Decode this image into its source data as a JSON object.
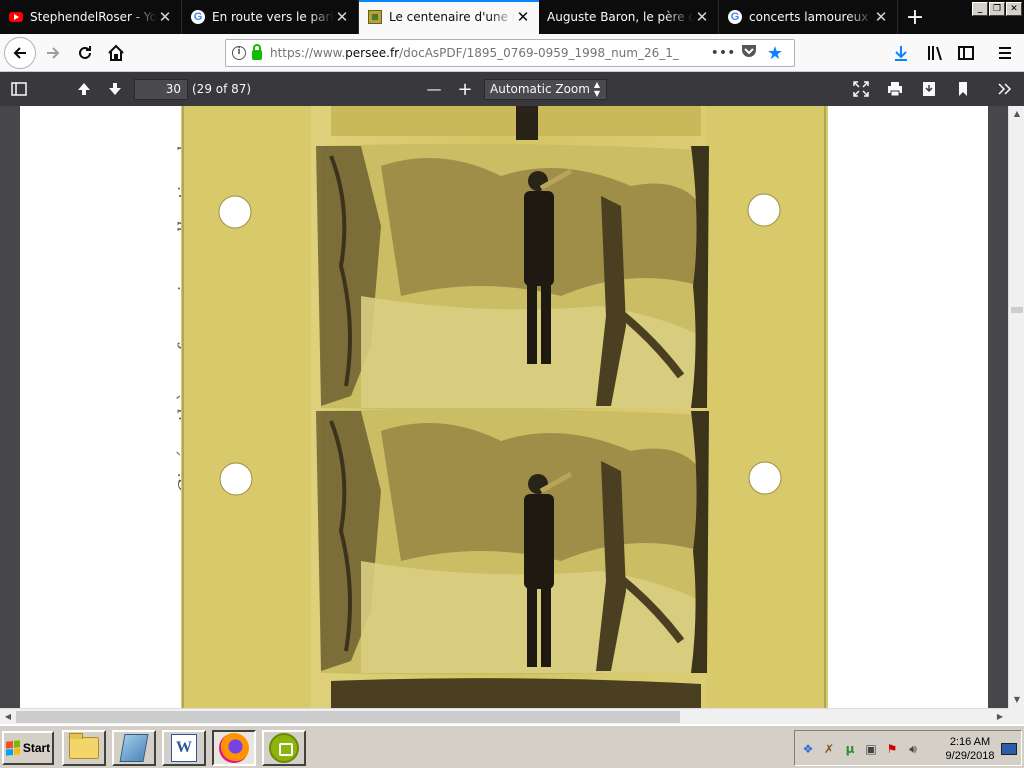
{
  "tabs": [
    {
      "label": "StephendelRoser - YouTube",
      "favicon": "youtube-icon",
      "active": false
    },
    {
      "label": "En route vers le parlant : h",
      "favicon": "google-icon",
      "active": false
    },
    {
      "label": "Le centenaire d'une rencontre",
      "favicon": "persee-icon",
      "active": true
    },
    {
      "label": "Auguste Baron, le père du cinéma",
      "favicon": "none",
      "active": false
    },
    {
      "label": "concerts lamoureux - Recherche",
      "favicon": "google-icon",
      "active": false
    }
  ],
  "window_controls": {
    "minimize": "_",
    "restore": "❐",
    "close": "✕"
  },
  "navbar": {
    "url_prefix": "https://www.",
    "url_domain": "persee.fr",
    "url_rest": "/docAsPDF/1895_0769-0959_1998_num_26_1_",
    "page_actions": "•••"
  },
  "pdf_toolbar": {
    "page_number": "30",
    "page_count": "(29 of 87)",
    "zoom": "Automatic Zoom",
    "zoom_out": "—",
    "zoom_in": "+"
  },
  "document": {
    "caption": "Cinémathèque française, collection des appareils"
  },
  "taskbar": {
    "start_label": "Start",
    "time": "2:16 AM",
    "date": "9/29/2018"
  },
  "colors": {
    "accent": "#0a84ff",
    "dark_tab_strip": "#0c0c0d",
    "pdf_toolbar": "#38383d",
    "film_base": "#d9cc6a",
    "secure_green": "#12bc00"
  }
}
